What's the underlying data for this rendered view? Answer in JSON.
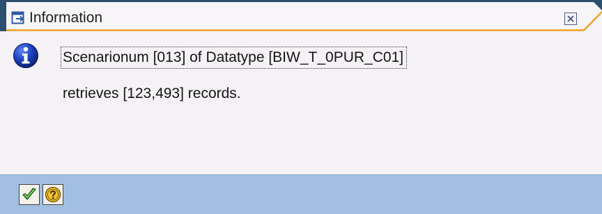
{
  "window": {
    "title": "Information",
    "title_icon": "message-dialog-icon",
    "close_icon": "close-icon"
  },
  "message": {
    "icon": "info-icon",
    "line1": "Scenarionum [013] of Datatype [BIW_T_0PUR_C01]",
    "line2": "retrieves [123,493] records."
  },
  "toolbar": {
    "ok_icon": "checkmark-icon",
    "help_icon": "question-help-icon"
  },
  "colors": {
    "titlebar_dark": "#2b4f6e",
    "accent_orange": "#f0a023",
    "body_bg": "#f5f2f5",
    "footer_bg": "#a2bfe1",
    "info_blue": "#1a3fb8"
  }
}
